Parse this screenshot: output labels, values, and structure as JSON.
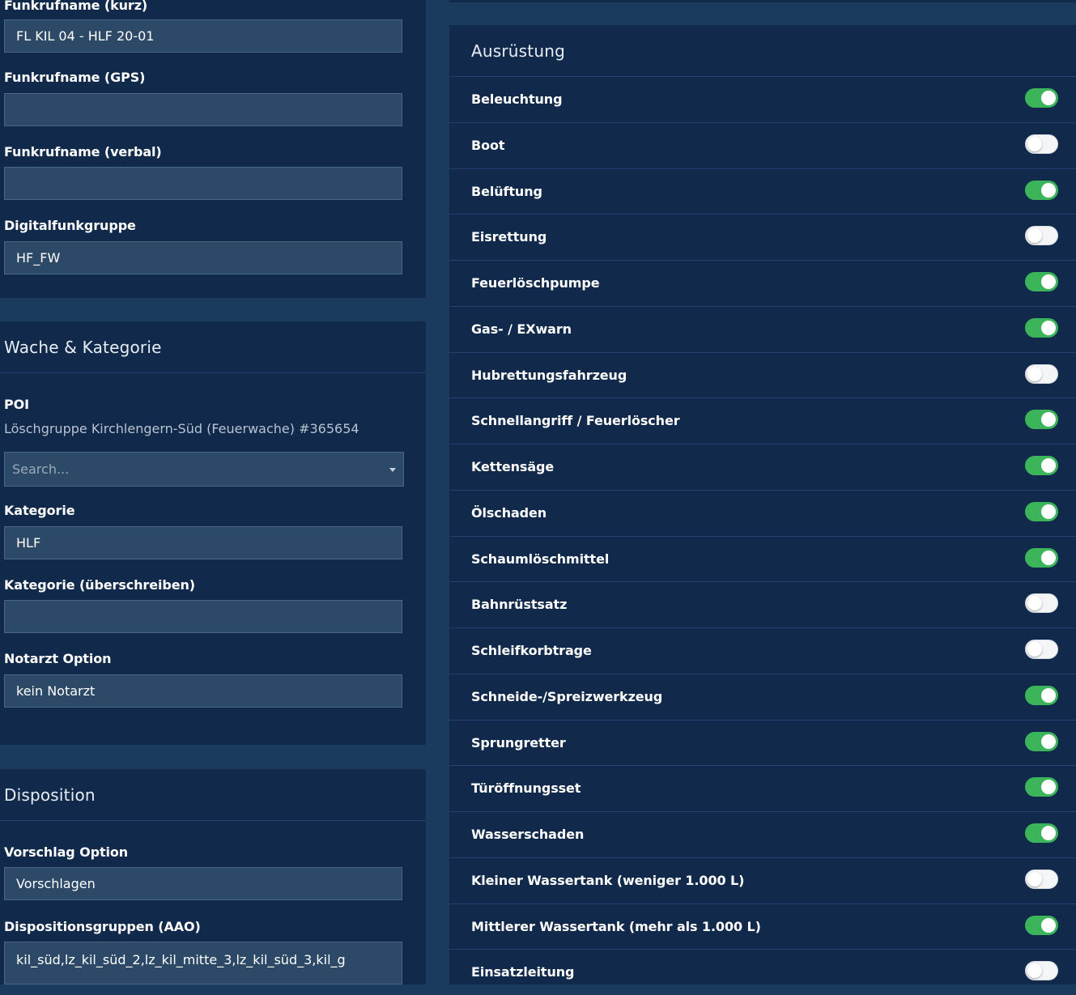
{
  "radio": {
    "short_name_label": "Funkrufname (kurz)",
    "short_name_value": "FL KIL 04 - HLF 20-01",
    "gps_name_label": "Funkrufname (GPS)",
    "gps_name_value": "",
    "verbal_name_label": "Funkrufname (verbal)",
    "verbal_name_value": "",
    "digital_group_label": "Digitalfunkgruppe",
    "digital_group_value": "HF_FW"
  },
  "station": {
    "title": "Wache & Kategorie",
    "poi_label": "POI",
    "poi_value": "Löschgruppe Kirchlengern-Süd (Feuerwache) #365654",
    "poi_search_placeholder": "Search...",
    "category_label": "Kategorie",
    "category_value": "HLF",
    "category_override_label": "Kategorie (überschreiben)",
    "category_override_value": "",
    "doctor_option_label": "Notarzt Option",
    "doctor_option_value": "kein Notarzt"
  },
  "disposition": {
    "title": "Disposition",
    "proposal_option_label": "Vorschlag Option",
    "proposal_option_value": "Vorschlagen",
    "groups_label": "Dispositionsgruppen (AAO)",
    "groups_value": "kil_süd,lz_kil_süd_2,lz_kil_mitte_3,lz_kil_süd_3,kil_g"
  },
  "equipment": {
    "title": "Ausrüstung",
    "items": [
      {
        "label": "Beleuchtung",
        "on": true
      },
      {
        "label": "Boot",
        "on": false
      },
      {
        "label": "Belüftung",
        "on": true
      },
      {
        "label": "Eisrettung",
        "on": false
      },
      {
        "label": "Feuerlöschpumpe",
        "on": true
      },
      {
        "label": "Gas- / EXwarn",
        "on": true
      },
      {
        "label": "Hubrettungsfahrzeug",
        "on": false
      },
      {
        "label": "Schnellangriff / Feuerlöscher",
        "on": true
      },
      {
        "label": "Kettensäge",
        "on": true
      },
      {
        "label": "Ölschaden",
        "on": true
      },
      {
        "label": "Schaumlöschmittel",
        "on": true
      },
      {
        "label": "Bahnrüstsatz",
        "on": false
      },
      {
        "label": "Schleifkorbtrage",
        "on": false
      },
      {
        "label": "Schneide-/Spreizwerkzeug",
        "on": true
      },
      {
        "label": "Sprungretter",
        "on": true
      },
      {
        "label": "Türöffnungsset",
        "on": true
      },
      {
        "label": "Wasserschaden",
        "on": true
      },
      {
        "label": "Kleiner Wassertank (weniger 1.000 L)",
        "on": false
      },
      {
        "label": "Mittlerer Wassertank (mehr als 1.000 L)",
        "on": true
      },
      {
        "label": "Einsatzleitung",
        "on": false
      }
    ]
  },
  "colors": {
    "background": "#1b3b5e",
    "panel": "#11294a",
    "input": "#2c4967",
    "toggle_on": "#3cb55a",
    "toggle_off": "#f3f5f7"
  }
}
